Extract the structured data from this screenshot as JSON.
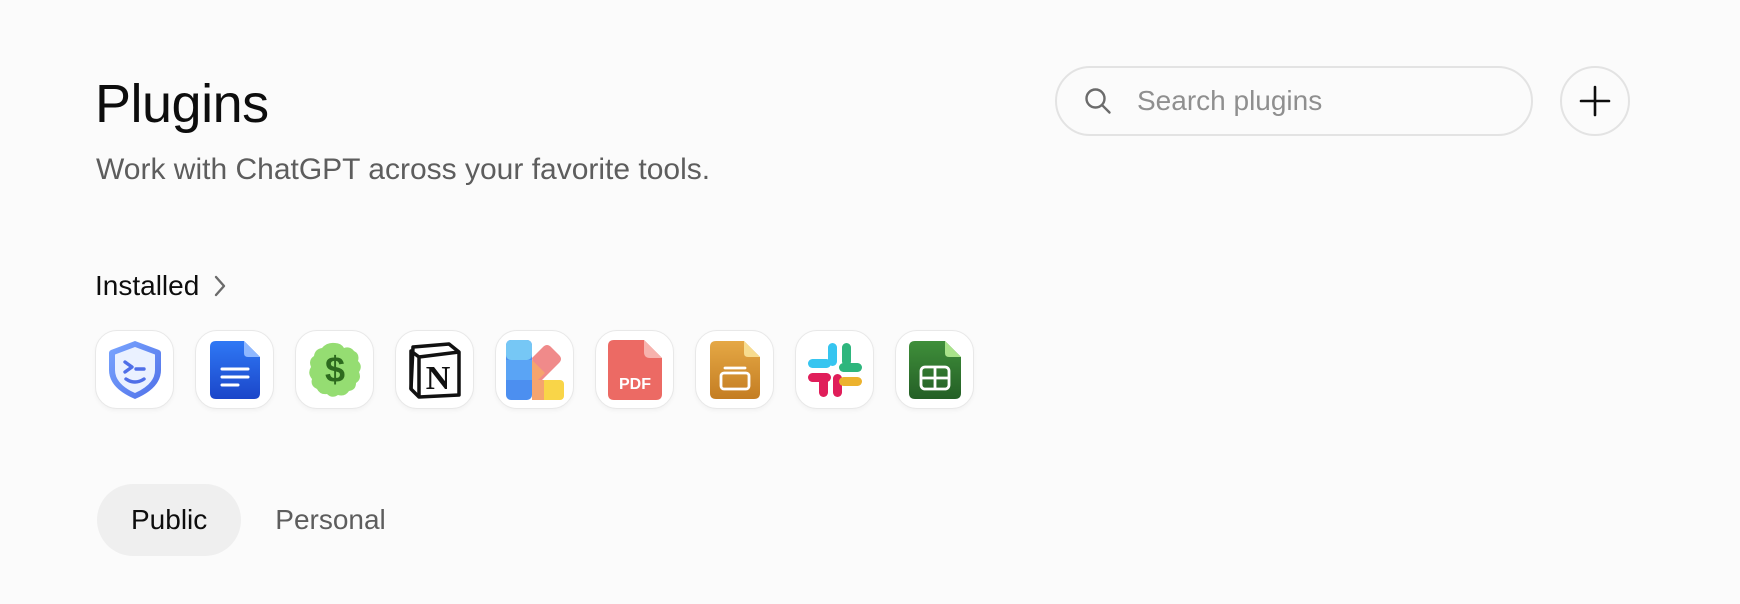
{
  "header": {
    "title": "Plugins",
    "subtitle": "Work with ChatGPT across your favorite tools."
  },
  "search": {
    "placeholder": "Search plugins",
    "value": "",
    "icon": "search-icon"
  },
  "add_button": {
    "icon": "plus-icon"
  },
  "installed": {
    "label": "Installed",
    "icon": "chevron-right-icon",
    "plugins": [
      {
        "icon": "shield-terminal-icon",
        "accent": "#5b8cf5"
      },
      {
        "icon": "document-icon",
        "accent": "#1f5fe0"
      },
      {
        "icon": "dollar-badge-icon",
        "accent": "#8fd66a"
      },
      {
        "icon": "notion-icon",
        "accent": "#111111"
      },
      {
        "icon": "color-palette-icon",
        "accent": "#f27c7c"
      },
      {
        "icon": "pdf-icon",
        "label": "PDF",
        "accent": "#ee6a62"
      },
      {
        "icon": "slides-icon",
        "accent": "#d6922e"
      },
      {
        "icon": "slack-icon",
        "accent": "#e01e5a"
      },
      {
        "icon": "spreadsheet-icon",
        "accent": "#2f7a33"
      }
    ]
  },
  "tabs": [
    {
      "label": "Public",
      "active": true
    },
    {
      "label": "Personal",
      "active": false
    }
  ]
}
